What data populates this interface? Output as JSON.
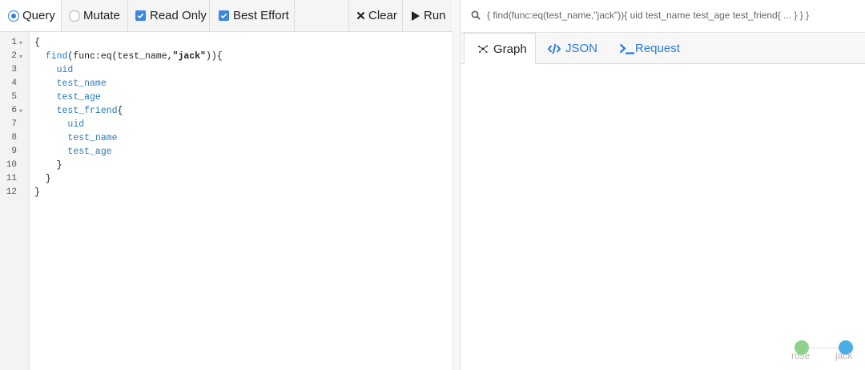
{
  "toolbar": {
    "query_label": "Query",
    "mutate_label": "Mutate",
    "read_only_label": "Read Only",
    "best_effort_label": "Best Effort",
    "clear_label": "Clear",
    "run_label": "Run",
    "mode_selected": "Query",
    "read_only_checked": true,
    "best_effort_checked": true
  },
  "editor": {
    "line_numbers": [
      "1",
      "2",
      "3",
      "4",
      "5",
      "6",
      "7",
      "8",
      "9",
      "10",
      "11",
      "12"
    ],
    "lines": [
      [
        {
          "t": "{",
          "c": "pun"
        }
      ],
      [
        {
          "t": "  ",
          "c": "pun"
        },
        {
          "t": "find",
          "c": "fn"
        },
        {
          "t": "(func:eq(test_name,",
          "c": "pun"
        },
        {
          "t": "\"jack\"",
          "c": "str"
        },
        {
          "t": ")){",
          "c": "pun"
        }
      ],
      [
        {
          "t": "    ",
          "c": "pun"
        },
        {
          "t": "uid",
          "c": "field"
        }
      ],
      [
        {
          "t": "    ",
          "c": "pun"
        },
        {
          "t": "test_name",
          "c": "field"
        }
      ],
      [
        {
          "t": "    ",
          "c": "pun"
        },
        {
          "t": "test_age",
          "c": "field"
        }
      ],
      [
        {
          "t": "    ",
          "c": "pun"
        },
        {
          "t": "test_friend",
          "c": "field"
        },
        {
          "t": "{",
          "c": "pun"
        }
      ],
      [
        {
          "t": "      ",
          "c": "pun"
        },
        {
          "t": "uid",
          "c": "field"
        }
      ],
      [
        {
          "t": "      ",
          "c": "pun"
        },
        {
          "t": "test_name",
          "c": "field"
        }
      ],
      [
        {
          "t": "      ",
          "c": "pun"
        },
        {
          "t": "test_age",
          "c": "field"
        }
      ],
      [
        {
          "t": "    }",
          "c": "pun"
        }
      ],
      [
        {
          "t": "  }",
          "c": "pun"
        }
      ],
      [
        {
          "t": "}",
          "c": "pun"
        }
      ]
    ]
  },
  "query_header": {
    "text": "{ find(func:eq(test_name,\"jack\")){ uid test_name test_age test_friend{ ... } } }"
  },
  "tabs": {
    "graph_label": "Graph",
    "json_label": "JSON",
    "request_label": "Request",
    "active": "Graph"
  },
  "graph": {
    "nodes": [
      {
        "label": "rose",
        "color": "#8fd18b"
      },
      {
        "label": "jack",
        "color": "#4aaee6"
      }
    ]
  },
  "colors": {
    "accent": "#2a7ae2",
    "checkbox": "#3b86e0"
  }
}
